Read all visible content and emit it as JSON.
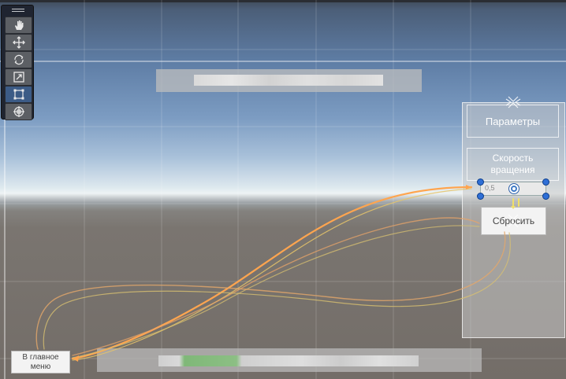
{
  "params_panel": {
    "label": "Параметры"
  },
  "speed_panel": {
    "label_line1": "Скорость",
    "label_line2": "вращения"
  },
  "slider": {
    "value_text": "0,5",
    "value": 0.5
  },
  "reset_button": {
    "label": "Сбросить"
  },
  "main_menu_button": {
    "label_line1": "В главное",
    "label_line2": "меню"
  },
  "toolbar": {
    "tools": [
      "hand-icon",
      "move-icon",
      "rotate-icon",
      "scale-icon",
      "rect-icon",
      "transform-icon"
    ],
    "active": "rect-icon"
  },
  "colors": {
    "navigation_primary": "#ffa54f",
    "navigation_secondary": "#e6c46a",
    "selection_handle": "#2f6fd6",
    "toolbar_active": "#3c5b86"
  }
}
